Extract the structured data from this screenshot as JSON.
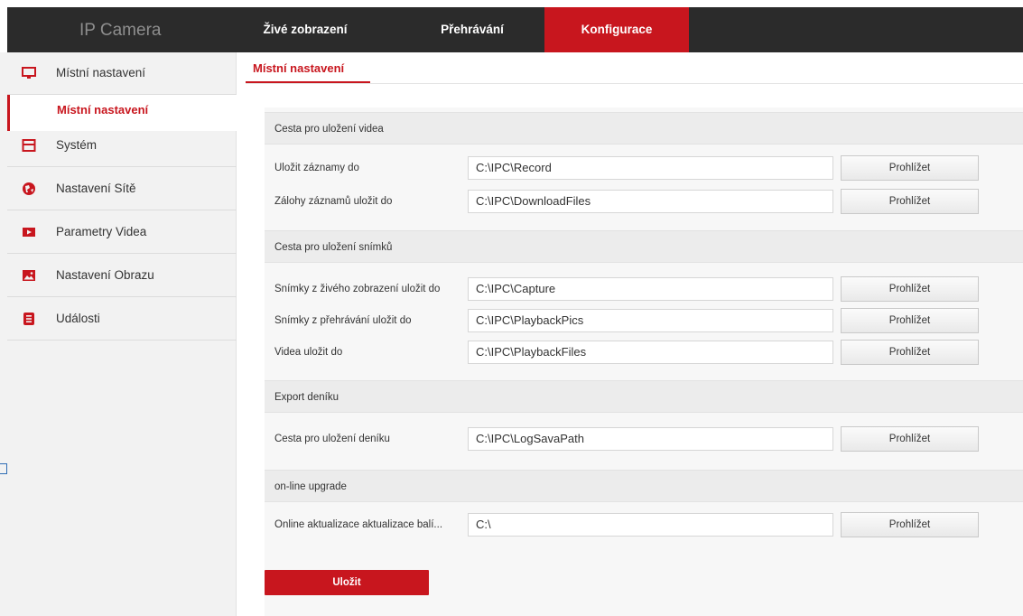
{
  "app": {
    "title": "IP Camera",
    "accent": "#c8161e"
  },
  "topnav": {
    "tabs": [
      {
        "label": "Živé zobrazení",
        "active": false
      },
      {
        "label": "Přehrávání",
        "active": false
      },
      {
        "label": "Konfigurace",
        "active": true
      }
    ]
  },
  "sidebar": {
    "items": [
      {
        "label": "Místní nastavení",
        "icon": "monitor-icon"
      },
      {
        "label": "Systém",
        "icon": "system-icon"
      },
      {
        "label": "Nastavení Sítě",
        "icon": "globe-icon"
      },
      {
        "label": "Parametry Videa",
        "icon": "video-icon"
      },
      {
        "label": "Nastavení Obrazu",
        "icon": "image-icon"
      },
      {
        "label": "Události",
        "icon": "events-icon"
      }
    ],
    "subitem": {
      "label": "Místní nastavení",
      "active": true
    }
  },
  "main": {
    "subtab": "Místní nastavení",
    "browse_label": "Prohlížet",
    "save_label": "Uložit",
    "sections": [
      {
        "title": "Cesta pro uložení videa",
        "rows": [
          {
            "label": "Uložit záznamy do",
            "value": "C:\\IPC\\Record"
          },
          {
            "label": "Zálohy záznamů uložit do",
            "value": "C:\\IPC\\DownloadFiles"
          }
        ]
      },
      {
        "title": "Cesta pro uložení snímků",
        "rows": [
          {
            "label": "Snímky z živého zobrazení uložit do",
            "value": "C:\\IPC\\Capture"
          },
          {
            "label": "Snímky z přehrávání uložit do",
            "value": "C:\\IPC\\PlaybackPics"
          },
          {
            "label": "Videa uložit do",
            "value": "C:\\IPC\\PlaybackFiles"
          }
        ]
      },
      {
        "title": "Export deníku",
        "rows": [
          {
            "label": "Cesta pro uložení deníku",
            "value": "C:\\IPC\\LogSavaPath"
          }
        ]
      },
      {
        "title": "on-line upgrade",
        "rows": [
          {
            "label": "Online aktualizace aktualizace balí...",
            "value": "C:\\"
          }
        ]
      }
    ]
  }
}
